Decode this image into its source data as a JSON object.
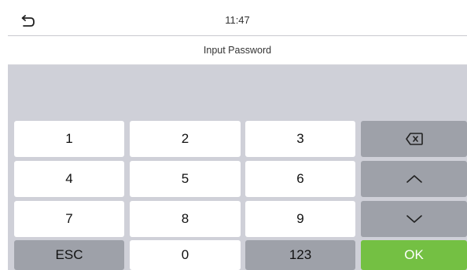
{
  "status_bar": {
    "back_icon": "return-arrow-icon",
    "time": "11:47"
  },
  "header": {
    "title": "Input Password"
  },
  "password_field": {
    "value": ""
  },
  "keypad": {
    "rows": [
      [
        "1",
        "2",
        "3"
      ],
      [
        "4",
        "5",
        "6"
      ],
      [
        "7",
        "8",
        "9"
      ]
    ],
    "bottom_row": {
      "esc": "ESC",
      "zero": "0",
      "mode": "123"
    },
    "side_keys": {
      "backspace_icon": "backspace-icon",
      "up_icon": "chevron-up-icon",
      "down_icon": "chevron-down-icon",
      "ok": "OK"
    }
  },
  "colors": {
    "ok_green": "#74c043",
    "function_gray": "#9ea1a9",
    "background": "#cfd0d8"
  }
}
